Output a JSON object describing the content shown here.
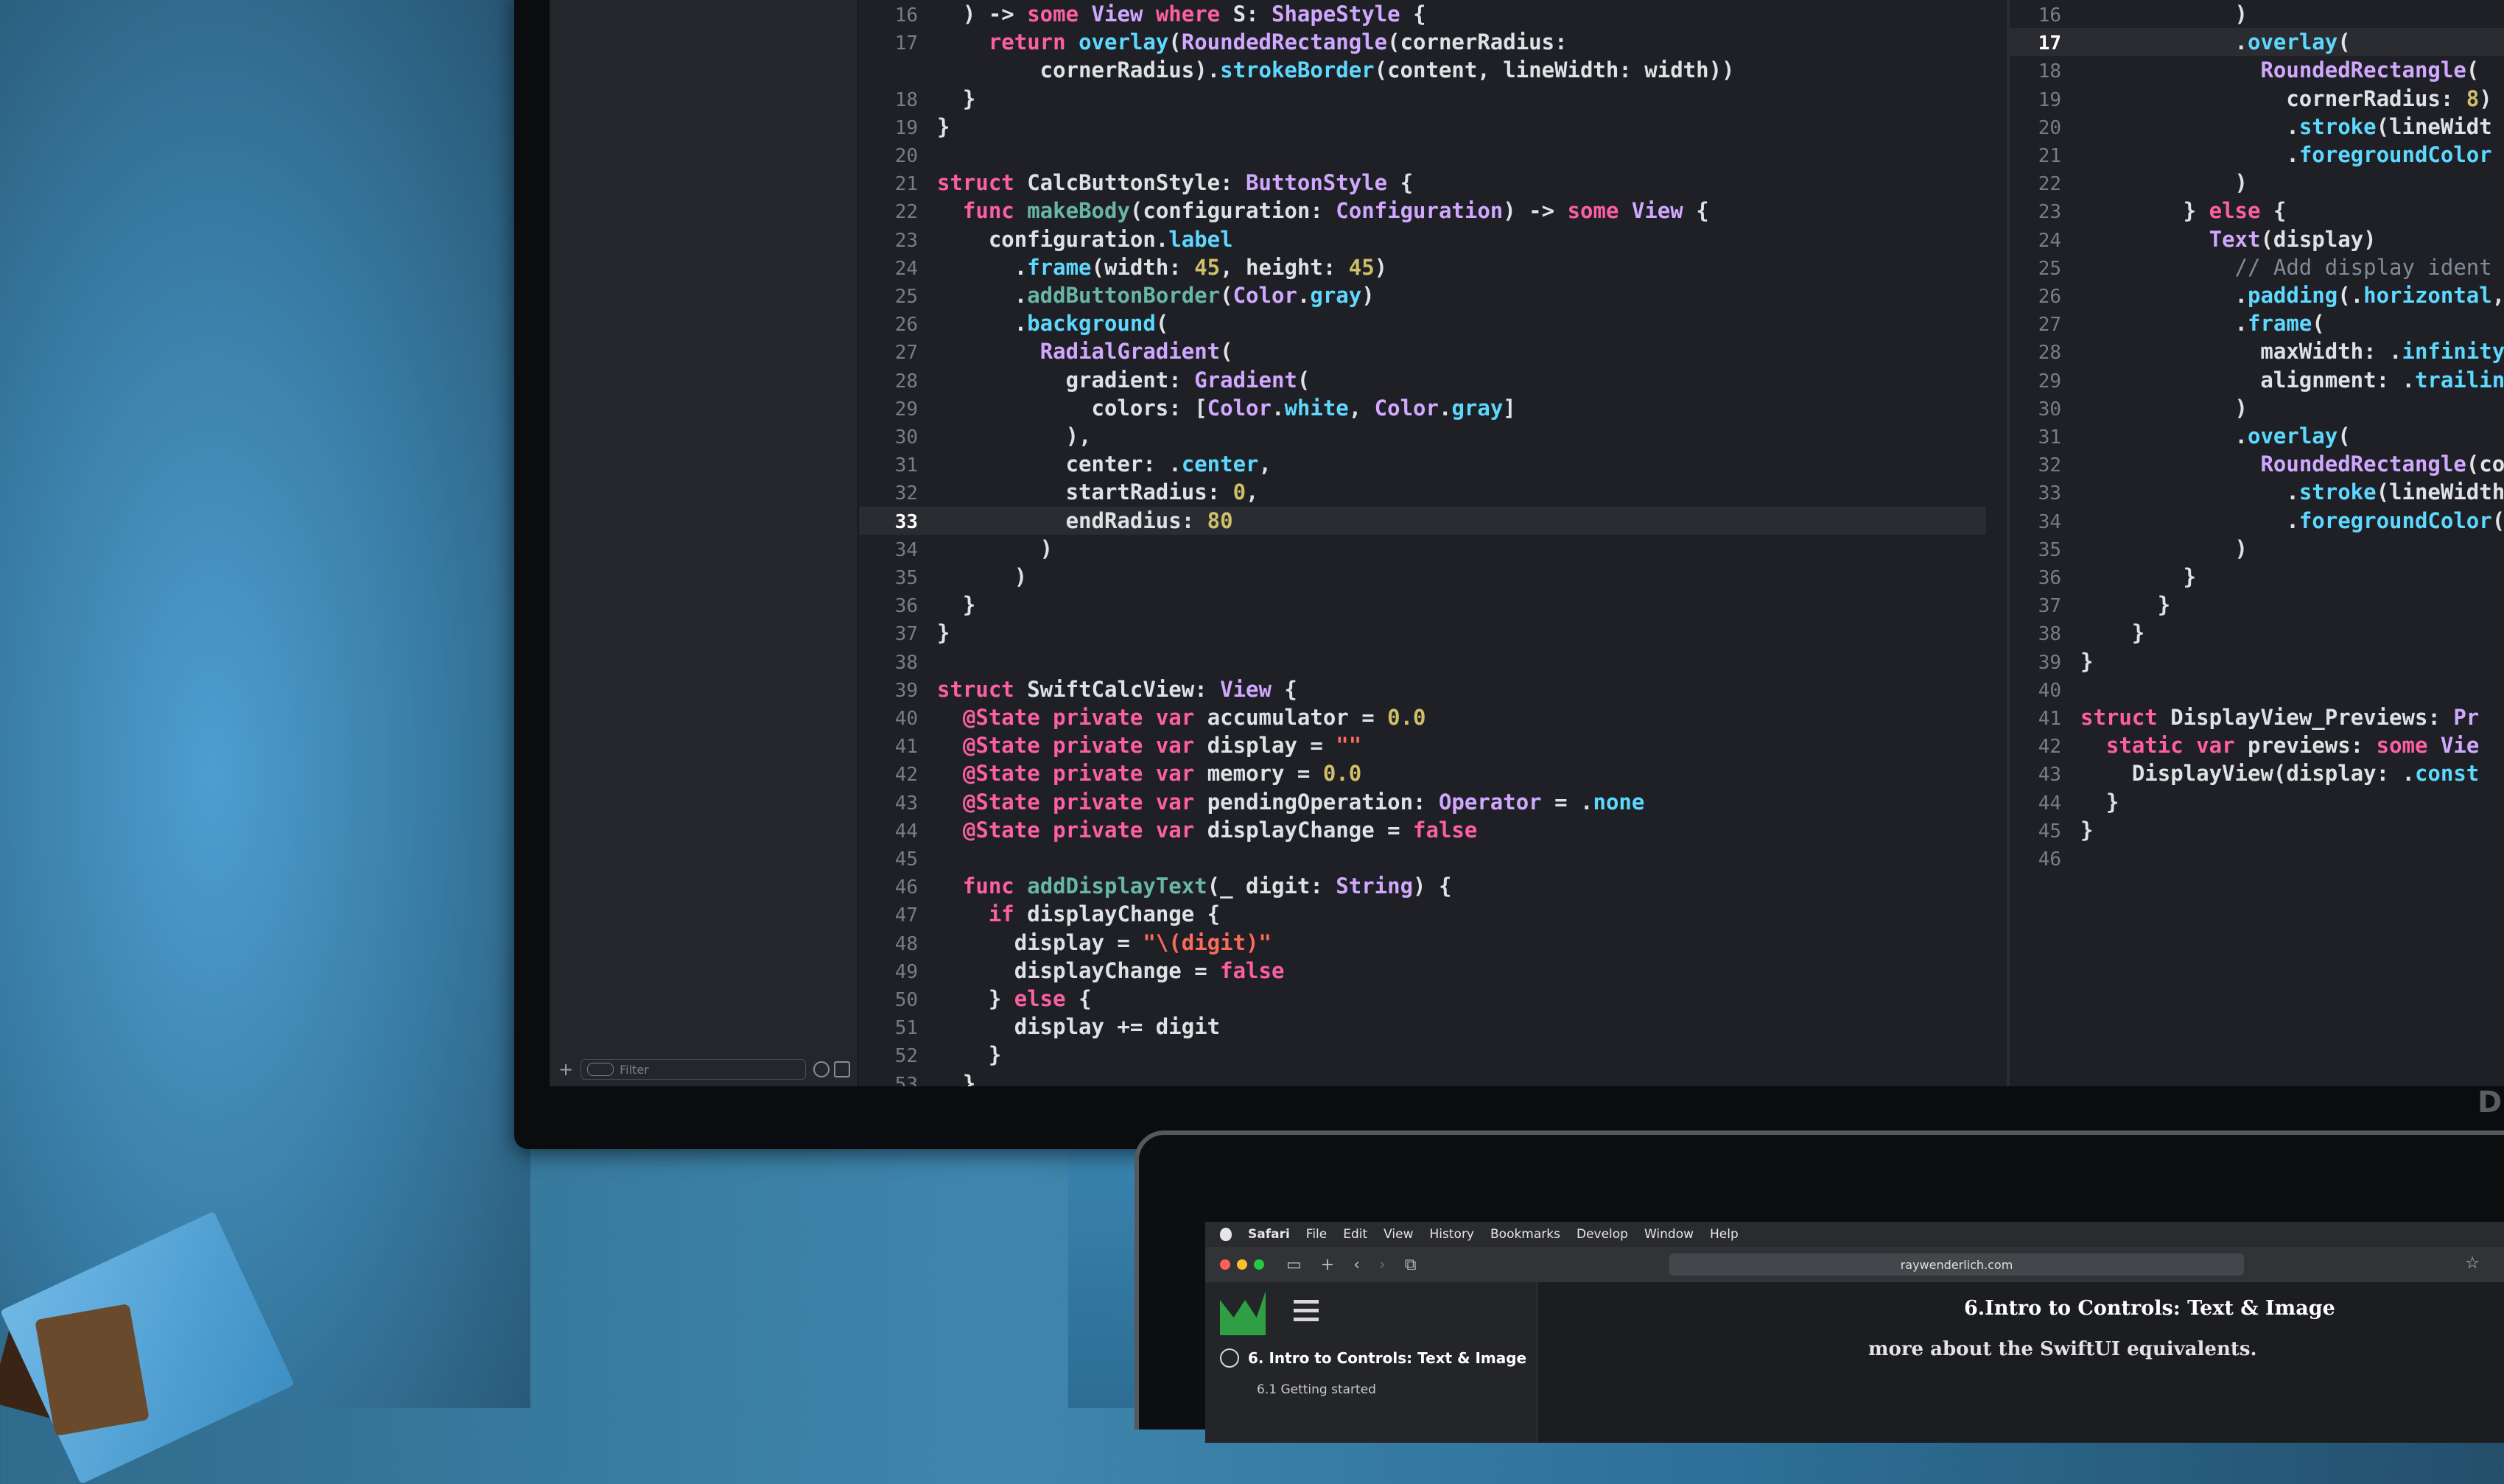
{
  "editor_left": {
    "current_line": 33,
    "lines": [
      {
        "n": "16",
        "t": [
          [
            "pl",
            "  ) -> "
          ],
          [
            "kw",
            "some"
          ],
          [
            "pl",
            " "
          ],
          [
            "ty",
            "View"
          ],
          [
            "pl",
            " "
          ],
          [
            "kw",
            "where"
          ],
          [
            "pl",
            " S: "
          ],
          [
            "ty",
            "ShapeStyle"
          ],
          [
            "pl",
            " {"
          ]
        ]
      },
      {
        "n": "17",
        "t": [
          [
            "pl",
            "    "
          ],
          [
            "kw",
            "return"
          ],
          [
            "pl",
            " "
          ],
          [
            "mb",
            "overlay"
          ],
          [
            "pl",
            "("
          ],
          [
            "ty",
            "RoundedRectangle"
          ],
          [
            "pl",
            "(cornerRadius:"
          ]
        ]
      },
      {
        "n": "",
        "t": [
          [
            "pl",
            "        cornerRadius)."
          ],
          [
            "mb",
            "strokeBorder"
          ],
          [
            "pl",
            "(content, lineWidth: width))"
          ]
        ]
      },
      {
        "n": "18",
        "t": [
          [
            "pl",
            "  }"
          ]
        ]
      },
      {
        "n": "19",
        "t": [
          [
            "pl",
            "}"
          ]
        ]
      },
      {
        "n": "20",
        "t": [
          [
            "pl",
            ""
          ]
        ]
      },
      {
        "n": "21",
        "t": [
          [
            "kw",
            "struct"
          ],
          [
            "pl",
            " CalcButtonStyle: "
          ],
          [
            "ty",
            "ButtonStyle"
          ],
          [
            "pl",
            " {"
          ]
        ]
      },
      {
        "n": "22",
        "t": [
          [
            "pl",
            "  "
          ],
          [
            "kw",
            "func"
          ],
          [
            "pl",
            " "
          ],
          [
            "fn",
            "makeBody"
          ],
          [
            "pl",
            "(configuration: "
          ],
          [
            "ty",
            "Configuration"
          ],
          [
            "pl",
            ") -> "
          ],
          [
            "kw",
            "some"
          ],
          [
            "pl",
            " "
          ],
          [
            "ty",
            "View"
          ],
          [
            "pl",
            " {"
          ]
        ]
      },
      {
        "n": "23",
        "t": [
          [
            "pl",
            "    configuration."
          ],
          [
            "mb",
            "label"
          ]
        ]
      },
      {
        "n": "24",
        "t": [
          [
            "pl",
            "      ."
          ],
          [
            "mb",
            "frame"
          ],
          [
            "pl",
            "(width: "
          ],
          [
            "num",
            "45"
          ],
          [
            "pl",
            ", height: "
          ],
          [
            "num",
            "45"
          ],
          [
            "pl",
            ")"
          ]
        ]
      },
      {
        "n": "25",
        "t": [
          [
            "pl",
            "      ."
          ],
          [
            "fn",
            "addButtonBorder"
          ],
          [
            "pl",
            "("
          ],
          [
            "ty",
            "Color"
          ],
          [
            "pl",
            "."
          ],
          [
            "mb",
            "gray"
          ],
          [
            "pl",
            ")"
          ]
        ]
      },
      {
        "n": "26",
        "t": [
          [
            "pl",
            "      ."
          ],
          [
            "mb",
            "background"
          ],
          [
            "pl",
            "("
          ]
        ]
      },
      {
        "n": "27",
        "t": [
          [
            "pl",
            "        "
          ],
          [
            "ty",
            "RadialGradient"
          ],
          [
            "pl",
            "("
          ]
        ]
      },
      {
        "n": "28",
        "t": [
          [
            "pl",
            "          gradient: "
          ],
          [
            "ty",
            "Gradient"
          ],
          [
            "pl",
            "("
          ]
        ]
      },
      {
        "n": "29",
        "t": [
          [
            "pl",
            "            colors: ["
          ],
          [
            "ty",
            "Color"
          ],
          [
            "pl",
            "."
          ],
          [
            "mb",
            "white"
          ],
          [
            "pl",
            ", "
          ],
          [
            "ty",
            "Color"
          ],
          [
            "pl",
            "."
          ],
          [
            "mb",
            "gray"
          ],
          [
            "pl",
            "]"
          ]
        ]
      },
      {
        "n": "30",
        "t": [
          [
            "pl",
            "          ),"
          ]
        ]
      },
      {
        "n": "31",
        "t": [
          [
            "pl",
            "          center: ."
          ],
          [
            "mb",
            "center"
          ],
          [
            "pl",
            ","
          ]
        ]
      },
      {
        "n": "32",
        "t": [
          [
            "pl",
            "          startRadius: "
          ],
          [
            "num",
            "0"
          ],
          [
            "pl",
            ","
          ]
        ]
      },
      {
        "n": "33",
        "t": [
          [
            "pl",
            "          endRadius: "
          ],
          [
            "num",
            "80"
          ]
        ]
      },
      {
        "n": "34",
        "t": [
          [
            "pl",
            "        )"
          ]
        ]
      },
      {
        "n": "35",
        "t": [
          [
            "pl",
            "      )"
          ]
        ]
      },
      {
        "n": "36",
        "t": [
          [
            "pl",
            "  }"
          ]
        ]
      },
      {
        "n": "37",
        "t": [
          [
            "pl",
            "}"
          ]
        ]
      },
      {
        "n": "38",
        "t": [
          [
            "pl",
            ""
          ]
        ]
      },
      {
        "n": "39",
        "t": [
          [
            "kw",
            "struct"
          ],
          [
            "pl",
            " SwiftCalcView: "
          ],
          [
            "ty",
            "View"
          ],
          [
            "pl",
            " {"
          ]
        ]
      },
      {
        "n": "40",
        "t": [
          [
            "pl",
            "  "
          ],
          [
            "kw",
            "@State"
          ],
          [
            "pl",
            " "
          ],
          [
            "kw",
            "private"
          ],
          [
            "pl",
            " "
          ],
          [
            "kw",
            "var"
          ],
          [
            "pl",
            " accumulator = "
          ],
          [
            "num",
            "0.0"
          ]
        ]
      },
      {
        "n": "41",
        "t": [
          [
            "pl",
            "  "
          ],
          [
            "kw",
            "@State"
          ],
          [
            "pl",
            " "
          ],
          [
            "kw",
            "private"
          ],
          [
            "pl",
            " "
          ],
          [
            "kw",
            "var"
          ],
          [
            "pl",
            " display = "
          ],
          [
            "str",
            "\"\""
          ]
        ]
      },
      {
        "n": "42",
        "t": [
          [
            "pl",
            "  "
          ],
          [
            "kw",
            "@State"
          ],
          [
            "pl",
            " "
          ],
          [
            "kw",
            "private"
          ],
          [
            "pl",
            " "
          ],
          [
            "kw",
            "var"
          ],
          [
            "pl",
            " memory = "
          ],
          [
            "num",
            "0.0"
          ]
        ]
      },
      {
        "n": "43",
        "t": [
          [
            "pl",
            "  "
          ],
          [
            "kw",
            "@State"
          ],
          [
            "pl",
            " "
          ],
          [
            "kw",
            "private"
          ],
          [
            "pl",
            " "
          ],
          [
            "kw",
            "var"
          ],
          [
            "pl",
            " pendingOperation: "
          ],
          [
            "ty",
            "Operator"
          ],
          [
            "pl",
            " = ."
          ],
          [
            "mb",
            "none"
          ]
        ]
      },
      {
        "n": "44",
        "t": [
          [
            "pl",
            "  "
          ],
          [
            "kw",
            "@State"
          ],
          [
            "pl",
            " "
          ],
          [
            "kw",
            "private"
          ],
          [
            "pl",
            " "
          ],
          [
            "kw",
            "var"
          ],
          [
            "pl",
            " displayChange = "
          ],
          [
            "kw",
            "false"
          ]
        ]
      },
      {
        "n": "45",
        "t": [
          [
            "pl",
            ""
          ]
        ]
      },
      {
        "n": "46",
        "t": [
          [
            "pl",
            "  "
          ],
          [
            "kw",
            "func"
          ],
          [
            "pl",
            " "
          ],
          [
            "fn",
            "addDisplayText"
          ],
          [
            "pl",
            "(_ digit: "
          ],
          [
            "ty",
            "String"
          ],
          [
            "pl",
            ") {"
          ]
        ]
      },
      {
        "n": "47",
        "t": [
          [
            "pl",
            "    "
          ],
          [
            "kw",
            "if"
          ],
          [
            "pl",
            " displayChange {"
          ]
        ]
      },
      {
        "n": "48",
        "t": [
          [
            "pl",
            "      display = "
          ],
          [
            "str",
            "\"\\(digit)\""
          ]
        ]
      },
      {
        "n": "49",
        "t": [
          [
            "pl",
            "      displayChange = "
          ],
          [
            "kw",
            "false"
          ]
        ]
      },
      {
        "n": "50",
        "t": [
          [
            "pl",
            "    } "
          ],
          [
            "kw",
            "else"
          ],
          [
            "pl",
            " {"
          ]
        ]
      },
      {
        "n": "51",
        "t": [
          [
            "pl",
            "      display += digit"
          ]
        ]
      },
      {
        "n": "52",
        "t": [
          [
            "pl",
            "    }"
          ]
        ]
      },
      {
        "n": "53",
        "t": [
          [
            "pl",
            "  }"
          ]
        ]
      }
    ]
  },
  "editor_right": {
    "current_line": 17,
    "lines": [
      {
        "n": "16",
        "t": [
          [
            "pl",
            "            )"
          ]
        ]
      },
      {
        "n": "17",
        "t": [
          [
            "pl",
            "            ."
          ],
          [
            "mb",
            "overlay"
          ],
          [
            "pl",
            "("
          ]
        ]
      },
      {
        "n": "18",
        "t": [
          [
            "pl",
            "              "
          ],
          [
            "ty",
            "RoundedRectangle"
          ],
          [
            "pl",
            "("
          ]
        ]
      },
      {
        "n": "19",
        "t": [
          [
            "pl",
            "                cornerRadius: "
          ],
          [
            "num",
            "8"
          ],
          [
            "pl",
            ")"
          ]
        ]
      },
      {
        "n": "20",
        "t": [
          [
            "pl",
            "                ."
          ],
          [
            "mb",
            "stroke"
          ],
          [
            "pl",
            "(lineWidt"
          ]
        ]
      },
      {
        "n": "21",
        "t": [
          [
            "pl",
            "                ."
          ],
          [
            "mb",
            "foregroundColor"
          ]
        ]
      },
      {
        "n": "22",
        "t": [
          [
            "pl",
            "            )"
          ]
        ]
      },
      {
        "n": "23",
        "t": [
          [
            "pl",
            "        } "
          ],
          [
            "kw",
            "else"
          ],
          [
            "pl",
            " {"
          ]
        ]
      },
      {
        "n": "24",
        "t": [
          [
            "pl",
            "          "
          ],
          [
            "ty",
            "Text"
          ],
          [
            "pl",
            "(display)"
          ]
        ]
      },
      {
        "n": "25",
        "t": [
          [
            "cm",
            "            // Add display ident"
          ]
        ]
      },
      {
        "n": "26",
        "t": [
          [
            "pl",
            "            ."
          ],
          [
            "mb",
            "padding"
          ],
          [
            "pl",
            "(."
          ],
          [
            "mb",
            "horizontal"
          ],
          [
            "pl",
            ","
          ]
        ]
      },
      {
        "n": "27",
        "t": [
          [
            "pl",
            "            ."
          ],
          [
            "mb",
            "frame"
          ],
          [
            "pl",
            "("
          ]
        ]
      },
      {
        "n": "28",
        "t": [
          [
            "pl",
            "              maxWidth: ."
          ],
          [
            "mb",
            "infinity"
          ]
        ]
      },
      {
        "n": "29",
        "t": [
          [
            "pl",
            "              alignment: ."
          ],
          [
            "mb",
            "trailin"
          ]
        ]
      },
      {
        "n": "30",
        "t": [
          [
            "pl",
            "            )"
          ]
        ]
      },
      {
        "n": "31",
        "t": [
          [
            "pl",
            "            ."
          ],
          [
            "mb",
            "overlay"
          ],
          [
            "pl",
            "("
          ]
        ]
      },
      {
        "n": "32",
        "t": [
          [
            "pl",
            "              "
          ],
          [
            "ty",
            "RoundedRectangle"
          ],
          [
            "pl",
            "(co"
          ]
        ]
      },
      {
        "n": "33",
        "t": [
          [
            "pl",
            "                ."
          ],
          [
            "mb",
            "stroke"
          ],
          [
            "pl",
            "(lineWidth"
          ]
        ]
      },
      {
        "n": "34",
        "t": [
          [
            "pl",
            "                ."
          ],
          [
            "mb",
            "foregroundColor"
          ],
          [
            "pl",
            "("
          ]
        ]
      },
      {
        "n": "35",
        "t": [
          [
            "pl",
            "            )"
          ]
        ]
      },
      {
        "n": "36",
        "t": [
          [
            "pl",
            "        }"
          ]
        ]
      },
      {
        "n": "37",
        "t": [
          [
            "pl",
            "      }"
          ]
        ]
      },
      {
        "n": "38",
        "t": [
          [
            "pl",
            "    }"
          ]
        ]
      },
      {
        "n": "39",
        "t": [
          [
            "pl",
            "}"
          ]
        ]
      },
      {
        "n": "40",
        "t": [
          [
            "pl",
            ""
          ]
        ]
      },
      {
        "n": "41",
        "t": [
          [
            "kw",
            "struct"
          ],
          [
            "pl",
            " DisplayView_Previews: "
          ],
          [
            "ty",
            "Pr"
          ]
        ]
      },
      {
        "n": "42",
        "t": [
          [
            "pl",
            "  "
          ],
          [
            "kw",
            "static"
          ],
          [
            "pl",
            " "
          ],
          [
            "kw",
            "var"
          ],
          [
            "pl",
            " previews: "
          ],
          [
            "kw",
            "some"
          ],
          [
            "pl",
            " "
          ],
          [
            "ty",
            "Vie"
          ]
        ]
      },
      {
        "n": "43",
        "t": [
          [
            "pl",
            "    DisplayView(display: ."
          ],
          [
            "mb",
            "const"
          ]
        ]
      },
      {
        "n": "44",
        "t": [
          [
            "pl",
            "  }"
          ]
        ]
      },
      {
        "n": "45",
        "t": [
          [
            "pl",
            "}"
          ]
        ]
      },
      {
        "n": "46",
        "t": [
          [
            "pl",
            ""
          ]
        ]
      }
    ]
  },
  "navigator": {
    "filter_placeholder": "Filter",
    "add_icon": "+"
  },
  "monitor_brand": "DELL",
  "safari": {
    "menu": [
      "Safari",
      "File",
      "Edit",
      "View",
      "History",
      "Bookmarks",
      "Develop",
      "Window",
      "Help"
    ],
    "url": "raywenderlich.com",
    "sidebar_chapter": "6. Intro to Controls: Text & Image",
    "sidebar_sub": "6.1 Getting started",
    "content_title": "6.Intro to Controls: Text & Image",
    "content_text": "more about the SwiftUI equivalents.",
    "traffic_colors": [
      "#ff5f57",
      "#febc2e",
      "#28c840"
    ]
  },
  "colors": {
    "keyword": "#fc5fa3",
    "type": "#d0a8ff",
    "member": "#5dd8ff",
    "number": "#d0bf69",
    "string": "#fc6a5d"
  }
}
